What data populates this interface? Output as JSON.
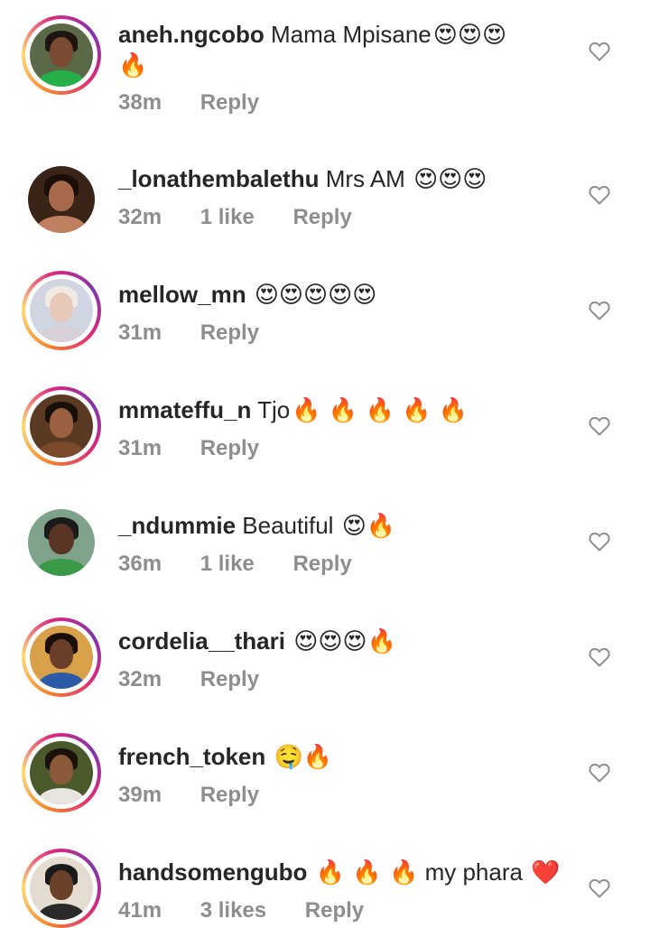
{
  "comments": [
    {
      "username": "aneh.ngcobo",
      "text": "Mama Mpisane",
      "emojis": "😍😍😍",
      "emojis_line2": "🔥",
      "time": "38m",
      "likes": "",
      "reply": "Reply",
      "avatar_colors": {
        "bg": "#5a6a48",
        "face": "#7a4a32",
        "body": "#27b04a",
        "hair": "#1e1410"
      }
    },
    {
      "username": "_lonathembalethu",
      "text": "Mrs AM",
      "emojis": "😍😍😍",
      "time": "32m",
      "likes": "1 like",
      "reply": "Reply",
      "avatar_colors": {
        "bg": "#3a2418",
        "face": "#a8684a",
        "body": "#c08060",
        "hair": "#1a0e08"
      }
    },
    {
      "username": "mellow_mn",
      "text": "",
      "emojis": "😍😍😍😍😍",
      "time": "31m",
      "likes": "",
      "reply": "Reply",
      "avatar_colors": {
        "bg": "#cfd6e2",
        "face": "#e8c8b8",
        "body": "#d8d0d8",
        "hair": "#f0ece4"
      }
    },
    {
      "username": "mmateffu_n",
      "text": "Tjo",
      "emojis": "🔥 🔥 🔥 🔥 🔥",
      "time": "31m",
      "likes": "",
      "reply": "Reply",
      "avatar_colors": {
        "bg": "#5a3a22",
        "face": "#9a6040",
        "body": "#7a4a2a",
        "hair": "#1a100a"
      }
    },
    {
      "username": "_ndummie",
      "text": "Beautiful",
      "emojis": "😍🔥",
      "time": "36m",
      "likes": "1 like",
      "reply": "Reply",
      "avatar_colors": {
        "bg": "#7ea38a",
        "face": "#5a3424",
        "body": "#3a9a48",
        "hair": "#1a1a1a"
      }
    },
    {
      "username": "cordelia__thari",
      "text": "",
      "emojis": "😍😍😍🔥",
      "time": "32m",
      "likes": "",
      "reply": "Reply",
      "avatar_colors": {
        "bg": "#d8a048",
        "face": "#6a3e28",
        "body": "#2a5aa8",
        "hair": "#1a0e08"
      }
    },
    {
      "username": "french_token",
      "text": "",
      "emojis": "🤤🔥",
      "time": "39m",
      "likes": "",
      "reply": "Reply",
      "avatar_colors": {
        "bg": "#4a5a2a",
        "face": "#8a5a3a",
        "body": "#e8e4e0",
        "hair": "#1a120a"
      }
    },
    {
      "username": "handsomengubo",
      "text": "my phara",
      "emojis": "🔥 🔥 🔥",
      "emojis_after": "❤️",
      "time": "41m",
      "likes": "3 likes",
      "reply": "Reply",
      "avatar_colors": {
        "bg": "#e4dcd0",
        "face": "#6a4028",
        "body": "#2a2a2a",
        "hair": "#1a1a1a"
      }
    }
  ],
  "icons": {
    "like": "heart-outline-icon"
  },
  "colors": {
    "username": "#262626",
    "meta": "#8e8e8e",
    "icon": "#8e8e8e"
  }
}
